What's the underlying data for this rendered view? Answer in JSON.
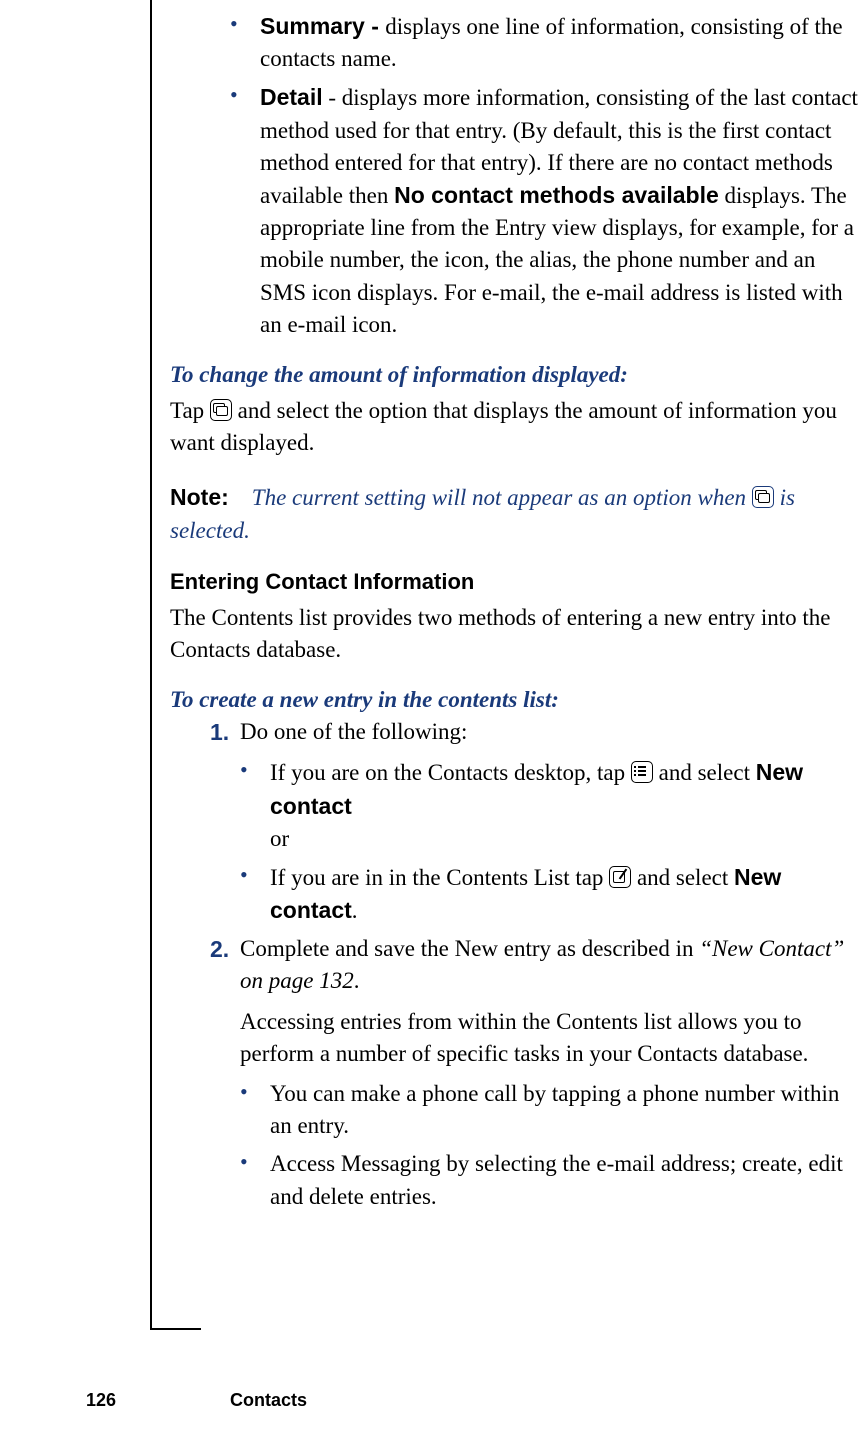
{
  "bullets_top": {
    "b1_label": "Summary - ",
    "b1_text": "displays one line of information, consisting of the contacts name.",
    "b2_label": "Detail",
    "b2_text_a": " - displays more information, consisting of the last contact method used for that entry. (By default, this is the first contact method entered for that entry). If there are no contact methods available then ",
    "b2_bold": "No contact methods available",
    "b2_text_b": " displays. The appropriate line from the Entry view displays, for example, for a mobile number, the icon, the alias, the phone number and an SMS icon displays. For e-mail, the e-mail address is listed with an e-mail icon."
  },
  "change_heading": "To change the amount of information displayed:",
  "change_text_a": "Tap ",
  "change_text_b": " and select the option that displays the amount of information you want displayed.",
  "note_label": "Note:",
  "note_text_a": "The current setting will not appear as an option when ",
  "note_text_b": " is selected.",
  "section_heading": "Entering Contact Information",
  "section_intro": "The Contents list provides two methods of entering a new entry into the Contacts database.",
  "create_heading": "To create a new entry in the contents list:",
  "steps": {
    "s1_num": "1.",
    "s1_text": " Do one of the following:",
    "s1_b1_a": "If you are on the Contacts desktop, tap ",
    "s1_b1_b": " and select ",
    "s1_b1_bold": "New contact",
    "s1_or": "or",
    "s1_b2_a": "If you are in in the Contents List tap ",
    "s1_b2_b": " and select ",
    "s1_b2_bold": "New contact",
    "s1_b2_c": ".",
    "s2_num": "2.",
    "s2_text_a": " Complete and save the New entry as described in ",
    "s2_ref": "“New Contact” on page 132",
    "s2_text_b": ".",
    "s2_para": "Accessing entries from within the Contents list allows you to perform a number of specific tasks in your Contacts database.",
    "s2_b1": "You can make a phone call by tapping a phone number within an entry.",
    "s2_b2": "Access Messaging by selecting the e-mail address; create, edit and delete entries."
  },
  "footer": {
    "page": "126",
    "title": "Contacts"
  }
}
